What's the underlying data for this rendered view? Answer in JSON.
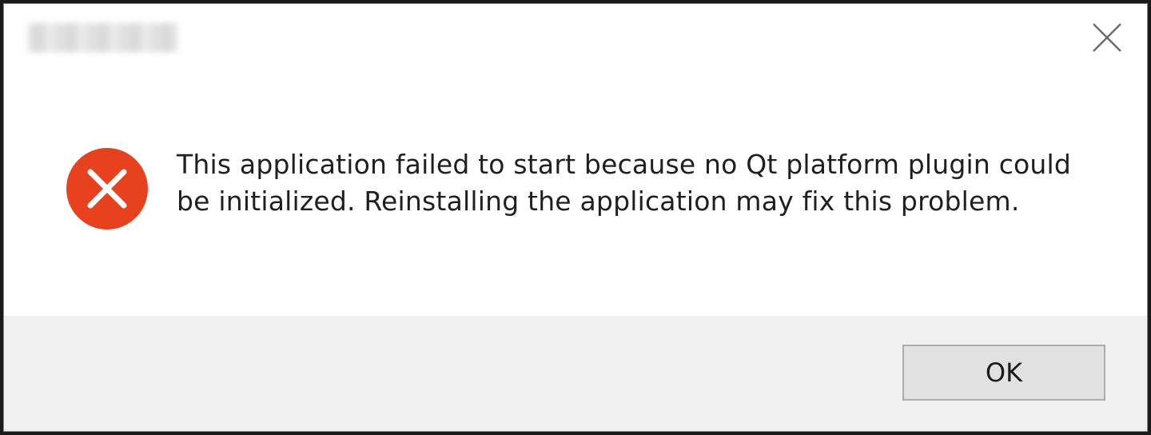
{
  "window": {
    "title": "",
    "close_icon": "close-icon"
  },
  "message": {
    "icon": "error-icon",
    "icon_color": "#e8411e",
    "text": "This application failed to start because no Qt platform plugin could be initialized. Reinstalling the application may fix this problem."
  },
  "footer": {
    "ok_label": "OK"
  }
}
